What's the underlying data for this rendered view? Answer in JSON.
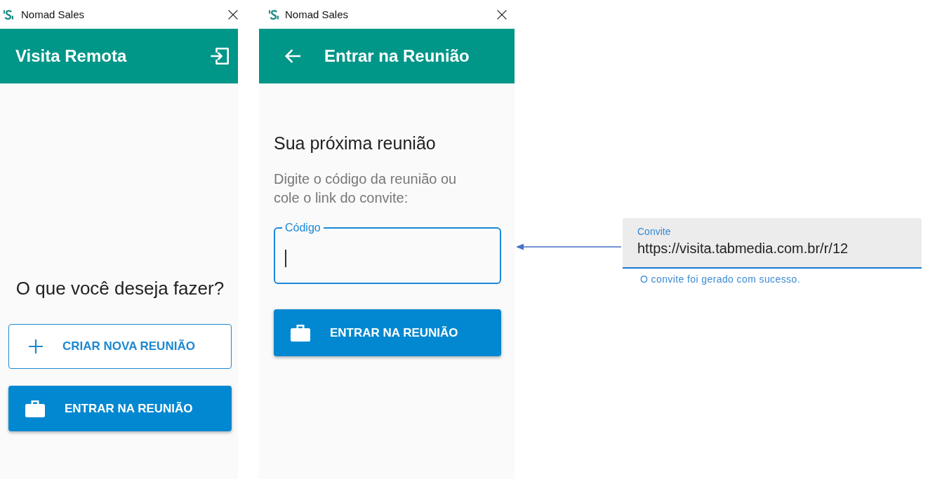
{
  "windows": [
    {
      "kind": "home",
      "title": "Nomad Sales",
      "app_bar": {
        "title": "Visita Remota"
      },
      "prompt": "O que você deseja fazer?",
      "buttons": [
        {
          "kind": "outlined",
          "label": "CRIAR NOVA REUNIÃO"
        },
        {
          "kind": "filled",
          "label": "ENTRAR NA REUNIÃO"
        }
      ]
    },
    {
      "kind": "join",
      "title": "Nomad Sales",
      "app_bar": {
        "title": "Entrar na Reunião"
      },
      "heading": "Sua próxima reunião",
      "instructions": "Digite o código da reunião ou cole o link do convite:",
      "field": {
        "label": "Código",
        "focused": true
      },
      "buttons": [
        {
          "kind": "filled",
          "label": "ENTRAR NA REUNIÃO"
        }
      ]
    }
  ],
  "invite_field": {
    "label": "Convite",
    "value": "https://visita.tabmedia.com.br/r/12",
    "focused": true,
    "helper": "O convite foi gerado com sucesso."
  }
}
